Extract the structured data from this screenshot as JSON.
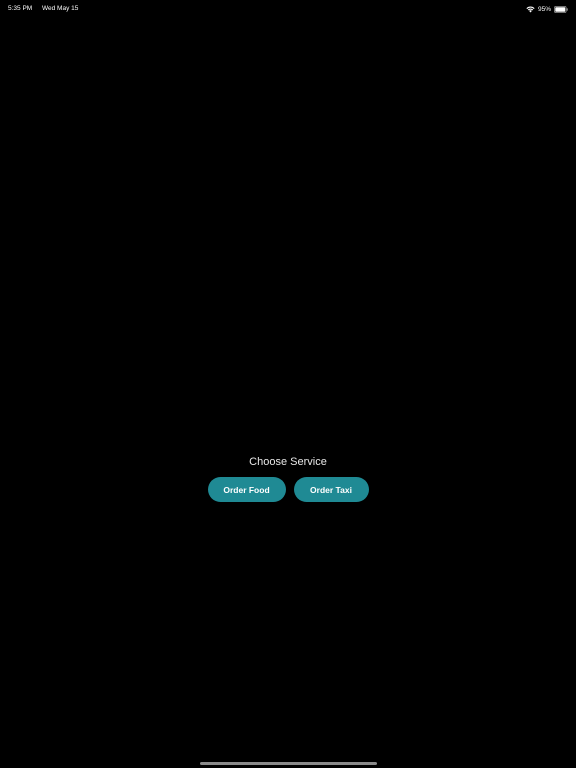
{
  "status_bar": {
    "time": "5:35 PM",
    "date": "Wed May 15",
    "battery_percent": "95%",
    "icons": [
      "wifi-icon",
      "battery-icon"
    ]
  },
  "main": {
    "title": "Choose Service",
    "buttons": [
      {
        "label": "Order Food"
      },
      {
        "label": "Order Taxi"
      }
    ]
  },
  "colors": {
    "background": "#000000",
    "button": "#1f8a94",
    "text": "#ffffff"
  }
}
